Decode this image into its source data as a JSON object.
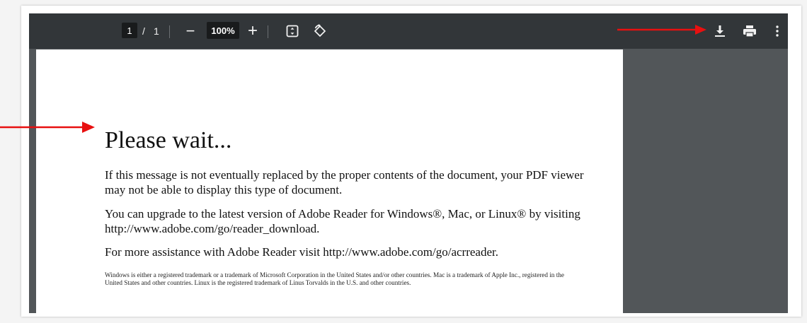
{
  "toolbar": {
    "current_page": "1",
    "page_separator": "/",
    "total_pages": "1",
    "zoom_out_label": "−",
    "zoom_level": "100%",
    "zoom_in_label": "+",
    "fit_icon": "fit-to-page-icon",
    "rotate_icon": "rotate-icon",
    "download_icon": "download-icon",
    "print_icon": "print-icon",
    "menu_icon": "more-vertical-icon"
  },
  "document": {
    "title": "Please wait...",
    "paragraph_1": "If this message is not eventually replaced by the proper contents of the document, your PDF viewer may not be able to display this type of document.",
    "paragraph_2": "You can upgrade to the latest version of Adobe Reader for Windows®, Mac, or Linux® by visiting  http://www.adobe.com/go/reader_download.",
    "paragraph_3": "For more assistance with Adobe Reader visit  http://www.adobe.com/go/acrreader.",
    "fine_print": "Windows is either a registered trademark or a trademark of Microsoft Corporation in the United States and/or other countries. Mac is a trademark of Apple Inc., registered in the United States and other countries. Linux is the registered trademark of Linus Torvalds in the U.S. and other countries."
  },
  "colors": {
    "toolbar_bg": "#323639",
    "viewer_bg": "#525659",
    "annotation_arrow": "#e81010"
  }
}
